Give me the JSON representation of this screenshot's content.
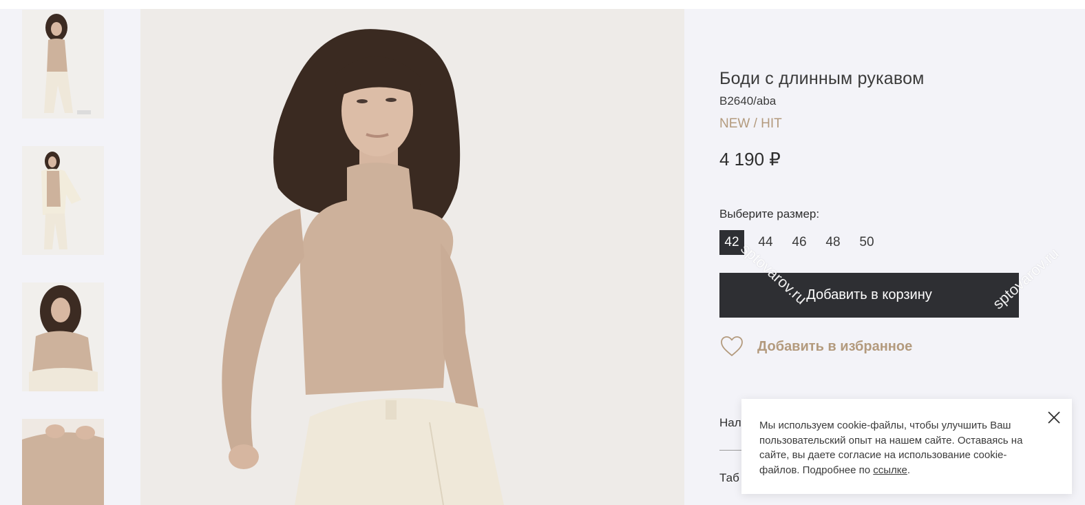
{
  "product": {
    "title": "Боди с длинным рукавом",
    "sku": "B2640/aba",
    "badge": "NEW / HIT",
    "price": "4 190 ₽"
  },
  "sizes": {
    "label": "Выберите размер:",
    "options": [
      "42",
      "44",
      "46",
      "48",
      "50"
    ],
    "selected": "42"
  },
  "actions": {
    "add_to_cart": "Добавить в корзину",
    "add_to_favorites": "Добавить в избранное"
  },
  "partial_sections": {
    "first": "Нал",
    "second": "Таб"
  },
  "watermarks": [
    "sptovarov.ru",
    "sptovarov.ru"
  ],
  "cookie": {
    "text": "Мы используем cookie-файлы, чтобы улучшить Ваш пользовательский опыт на нашем сайте. Оставаясь на сайте, вы даете согласие на использование cookie-файлов. Подробнее по ",
    "link": "ссылке",
    "tail": "."
  },
  "icons": {
    "favorite": "heart-icon",
    "close": "close-icon"
  },
  "colors": {
    "accent": "#b39a7d",
    "dark": "#2e2f33",
    "background": "#f3f3f8"
  }
}
